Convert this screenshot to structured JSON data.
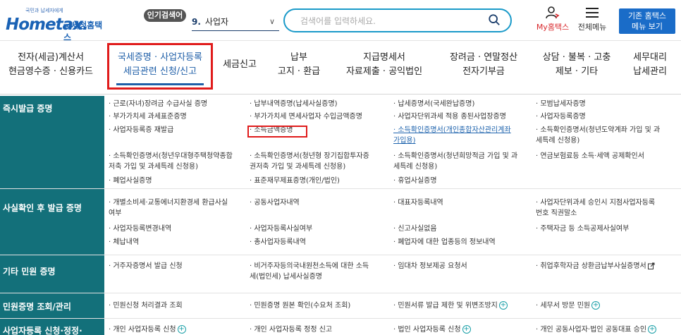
{
  "header": {
    "logo_small": "국민과 납세자에게",
    "logo_brand": "Hometax.",
    "logo_brand_ko": "국세청홈택스",
    "popular_badge": "인기검색어",
    "popular_rank": "9.",
    "popular_term": "사업자",
    "search_placeholder": "검색어를 입력하세요.",
    "myhome_label": "My홈택스",
    "allmenu_label": "전체메뉴",
    "classic_line1": "기존 홈택스",
    "classic_line2": "메뉴 보기"
  },
  "nav": [
    {
      "line1": "전자(세금)계산서",
      "line2": "현금영수증 · 신용카드"
    },
    {
      "line1": "국세증명 · 사업자등록",
      "line2": "세금관련 신청/신고"
    },
    {
      "line1": "세금신고",
      "line2": ""
    },
    {
      "line1": "납부",
      "line2": "고지 · 환급"
    },
    {
      "line1": "지급명세서",
      "line2": "자료제출 · 공익법인"
    },
    {
      "line1": "장려금 · 연말정산",
      "line2": "전자기부금"
    },
    {
      "line1": "상담 · 불복 · 고충",
      "line2": "제보 · 기타"
    },
    {
      "line1": "세무대리",
      "line2": "납세관리"
    }
  ],
  "rows": [
    {
      "title": "즉시발급 증명",
      "cells": [
        {
          "text": "· 근로(자녀)장려금 수급사실 증명"
        },
        {
          "text": "· 납부내역증명(납세사실증명)"
        },
        {
          "text": "· 납세증명서(국세완납증명)"
        },
        {
          "text": "· 모범납세자증명"
        },
        {
          "text": "· 부가가치세 과세표준증명"
        },
        {
          "text": "· 부가가치세 면세사업자 수입금액증명"
        },
        {
          "text": "· 사업자단위과세 적용 종된사업장증명"
        },
        {
          "text": "· 사업자등록증명"
        },
        {
          "text": "· 사업자등록증 재발급"
        },
        {
          "text": "· 소득금액증명"
        },
        {
          "text1": "· 소득확인증명서(개인종합자산관리계좌",
          "text2": "가입용)"
        },
        {
          "text1": "· 소득확인증명서(청년도약계좌 가입 및 과",
          "text2": "세특례 신청용)"
        },
        {
          "text1": "· 소득확인증명서(청년우대형주택청약종합",
          "text2": "저축 가입 및 과세특례 신청용)"
        },
        {
          "text1": "· 소득확인증명서(청년형 장기집합투자증",
          "text2": "권저축 가입 및 과세특례 신청용)"
        },
        {
          "text1": "· 소득확인증명서(청년희망적금 가입 및 과",
          "text2": "세특례 신청용)"
        },
        {
          "text": "· 연금보험료등 소득·세액 공제확인서"
        },
        {
          "text": "· 폐업사실증명"
        },
        {
          "text": "· 표준재무제표증명(개인/법인)"
        },
        {
          "text": "· 휴업사실증명"
        }
      ]
    },
    {
      "title": "사실확인 후 발급 증명",
      "cells": [
        {
          "text1": "· 개별소비세·교통에너지환경세 환급사실",
          "text2": "여부"
        },
        {
          "text": "· 공동사업자내역"
        },
        {
          "text": "· 대표자등록내역"
        },
        {
          "text1": "· 사업자단위과세 승인시 지점사업자등록",
          "text2": "번호 직권말소"
        },
        {
          "text": "· 사업자등록변경내역"
        },
        {
          "text": "· 사업자등록사실여부"
        },
        {
          "text": "· 신고사실없음"
        },
        {
          "text": "· 주택자금 등 소득공제사실여부"
        },
        {
          "text": "· 체납내역"
        },
        {
          "text": "· 총사업자등록내역"
        },
        {
          "text": "· 폐업자에 대한 업종등의 정보내역"
        }
      ]
    },
    {
      "title": "기타 민원 증명",
      "cells": [
        {
          "text": "· 거주자증명서 발급 신청"
        },
        {
          "text1": "· 비거주자등의국내원천소득에 대한 소득",
          "text2": "세(법인세) 납세사실증명"
        },
        {
          "text": "· 임대차 정보제공 요청서"
        },
        {
          "text": "· 취업후학자금 상환금납부사실증명서"
        }
      ]
    },
    {
      "title": "민원증명 조회/관리",
      "cells": [
        {
          "text": "· 민원신청 처리결과 조회"
        },
        {
          "text": "· 민원증명 원본 확인(수요처 조회)"
        },
        {
          "text": "· 민원서류 발급 제한 및 위변조방지"
        },
        {
          "text": "· 세무서 방문 민원"
        }
      ]
    },
    {
      "title": "사업자등록 신청·정정·",
      "cells": [
        {
          "text": "· 개인 사업자등록 신청"
        },
        {
          "text": "· 개인 사업자등록 정정 신고"
        },
        {
          "text": "· 법인 사업자등록 신청"
        },
        {
          "text": "· 개인 공동사업자·법인 공동대표 승인"
        }
      ]
    }
  ],
  "colors": {
    "accent": "#1f5fa8",
    "sidebar": "#13707a",
    "highlight": "#e01b1b",
    "myhome": "#d8282c"
  }
}
